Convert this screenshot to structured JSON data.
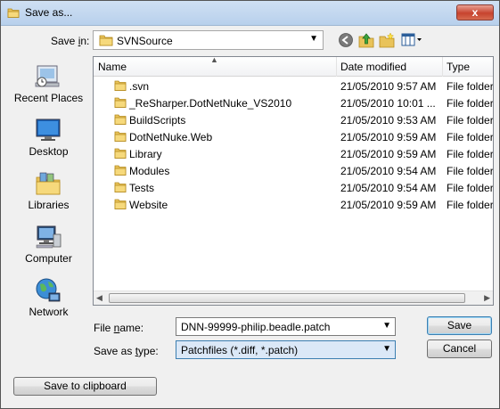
{
  "window": {
    "title": "Save as...",
    "close_label": "x"
  },
  "save_in": {
    "label_pre": "Save ",
    "label_ul": "i",
    "label_post": "n:",
    "value": "SVNSource"
  },
  "places": [
    {
      "label": "Recent Places",
      "icon": "recent-places-icon"
    },
    {
      "label": "Desktop",
      "icon": "desktop-icon"
    },
    {
      "label": "Libraries",
      "icon": "libraries-icon"
    },
    {
      "label": "Computer",
      "icon": "computer-icon"
    },
    {
      "label": "Network",
      "icon": "network-icon"
    }
  ],
  "columns": {
    "name": "Name",
    "date": "Date modified",
    "type": "Type"
  },
  "files": [
    {
      "name": ".svn",
      "date": "21/05/2010 9:57 AM",
      "type": "File folder"
    },
    {
      "name": "_ReSharper.DotNetNuke_VS2010",
      "date": "21/05/2010 10:01 ...",
      "type": "File folder"
    },
    {
      "name": "BuildScripts",
      "date": "21/05/2010 9:53 AM",
      "type": "File folder"
    },
    {
      "name": "DotNetNuke.Web",
      "date": "21/05/2010 9:59 AM",
      "type": "File folder"
    },
    {
      "name": "Library",
      "date": "21/05/2010 9:59 AM",
      "type": "File folder"
    },
    {
      "name": "Modules",
      "date": "21/05/2010 9:54 AM",
      "type": "File folder"
    },
    {
      "name": "Tests",
      "date": "21/05/2010 9:54 AM",
      "type": "File folder"
    },
    {
      "name": "Website",
      "date": "21/05/2010 9:59 AM",
      "type": "File folder"
    }
  ],
  "file_name": {
    "label_pre": "File ",
    "label_ul": "n",
    "label_post": "ame:",
    "value": "DNN-99999-philip.beadle.patch"
  },
  "save_type": {
    "label_pre": "Save as ",
    "label_ul": "t",
    "label_post": "ype:",
    "value": "Patchfiles (*.diff, *.patch)"
  },
  "buttons": {
    "save": "Save",
    "cancel": "Cancel",
    "clipboard": "Save to clipboard"
  }
}
